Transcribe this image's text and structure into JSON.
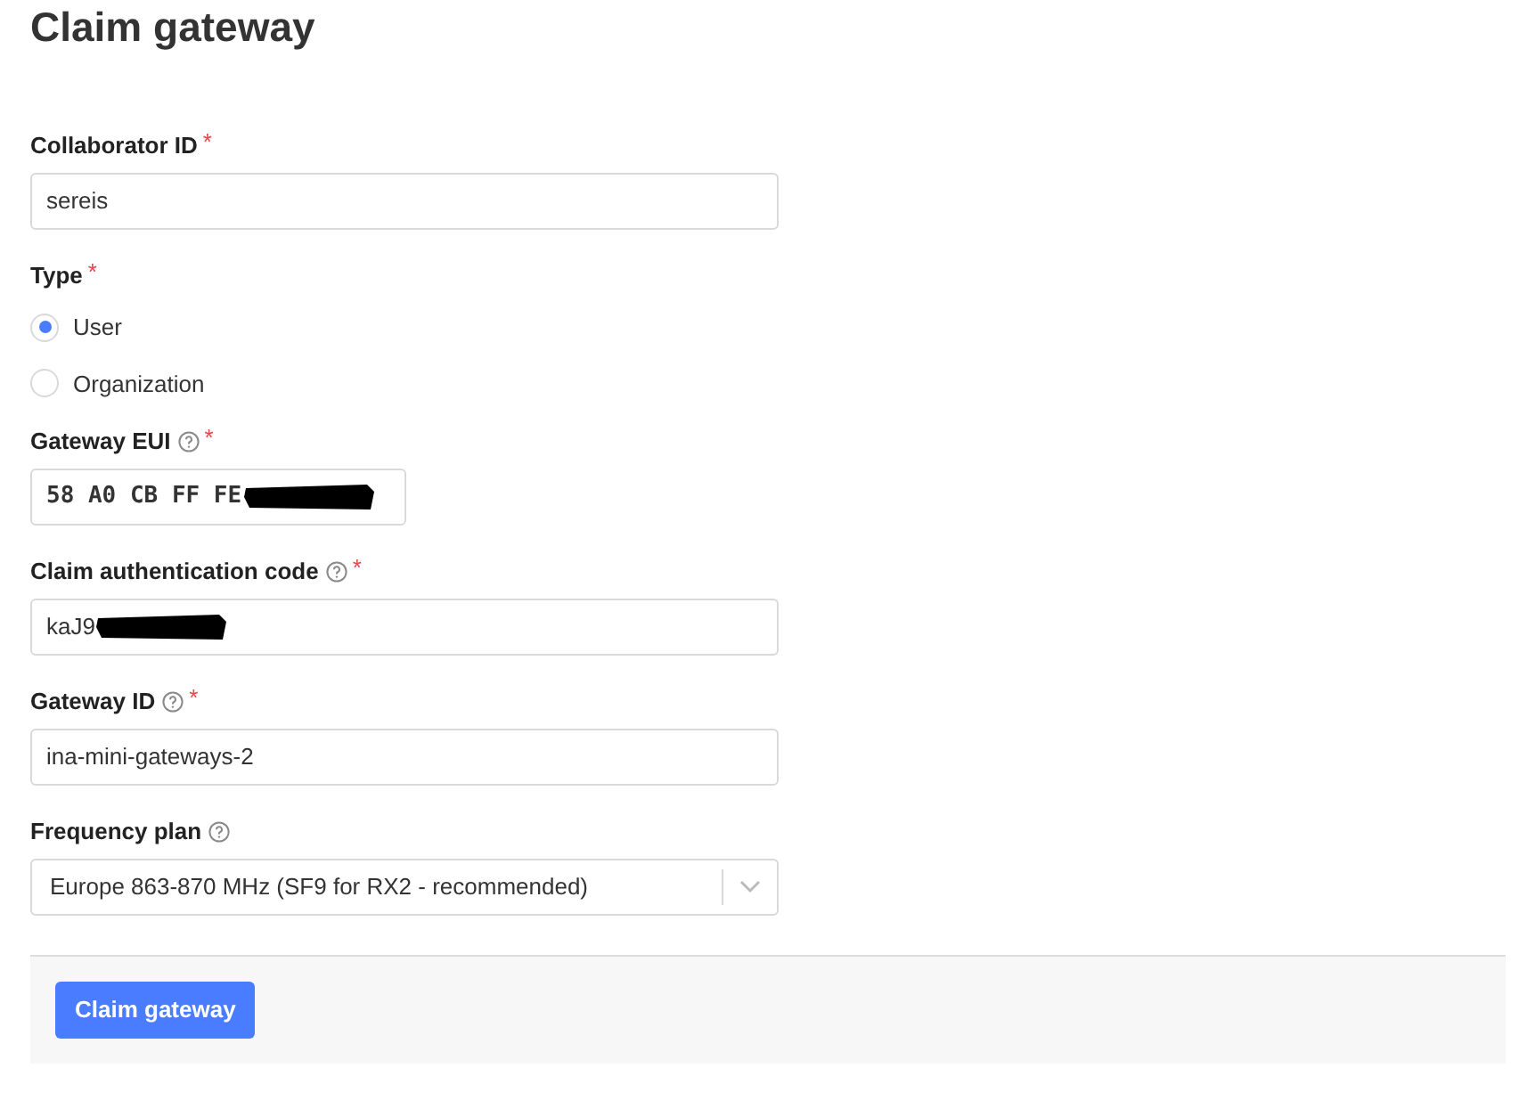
{
  "title": "Claim gateway",
  "fields": [
    {
      "kind": "text",
      "label": "Collaborator ID",
      "required_mark": "*",
      "help": false,
      "value": "sereis",
      "redacted": false
    },
    {
      "kind": "radio",
      "label": "Type",
      "required_mark": "*",
      "help": false,
      "options": [
        {
          "label": "User",
          "selected": true
        },
        {
          "label": "Organization",
          "selected": false
        }
      ]
    },
    {
      "kind": "hex",
      "label": "Gateway EUI",
      "required_mark": "*",
      "help": true,
      "value": "58 A0 CB FF FE",
      "redacted": true
    },
    {
      "kind": "text",
      "label": "Claim authentication code",
      "required_mark": "*",
      "help": true,
      "value": "kaJ9",
      "redacted": true
    },
    {
      "kind": "text",
      "label": "Gateway ID",
      "required_mark": "*",
      "help": true,
      "value": "ina-mini-gateways-2",
      "redacted": false
    },
    {
      "kind": "select",
      "label": "Frequency plan",
      "help": true,
      "value": "Europe 863-870 MHz (SF9 for RX2 - recommended)"
    }
  ],
  "submit": "Claim gateway"
}
